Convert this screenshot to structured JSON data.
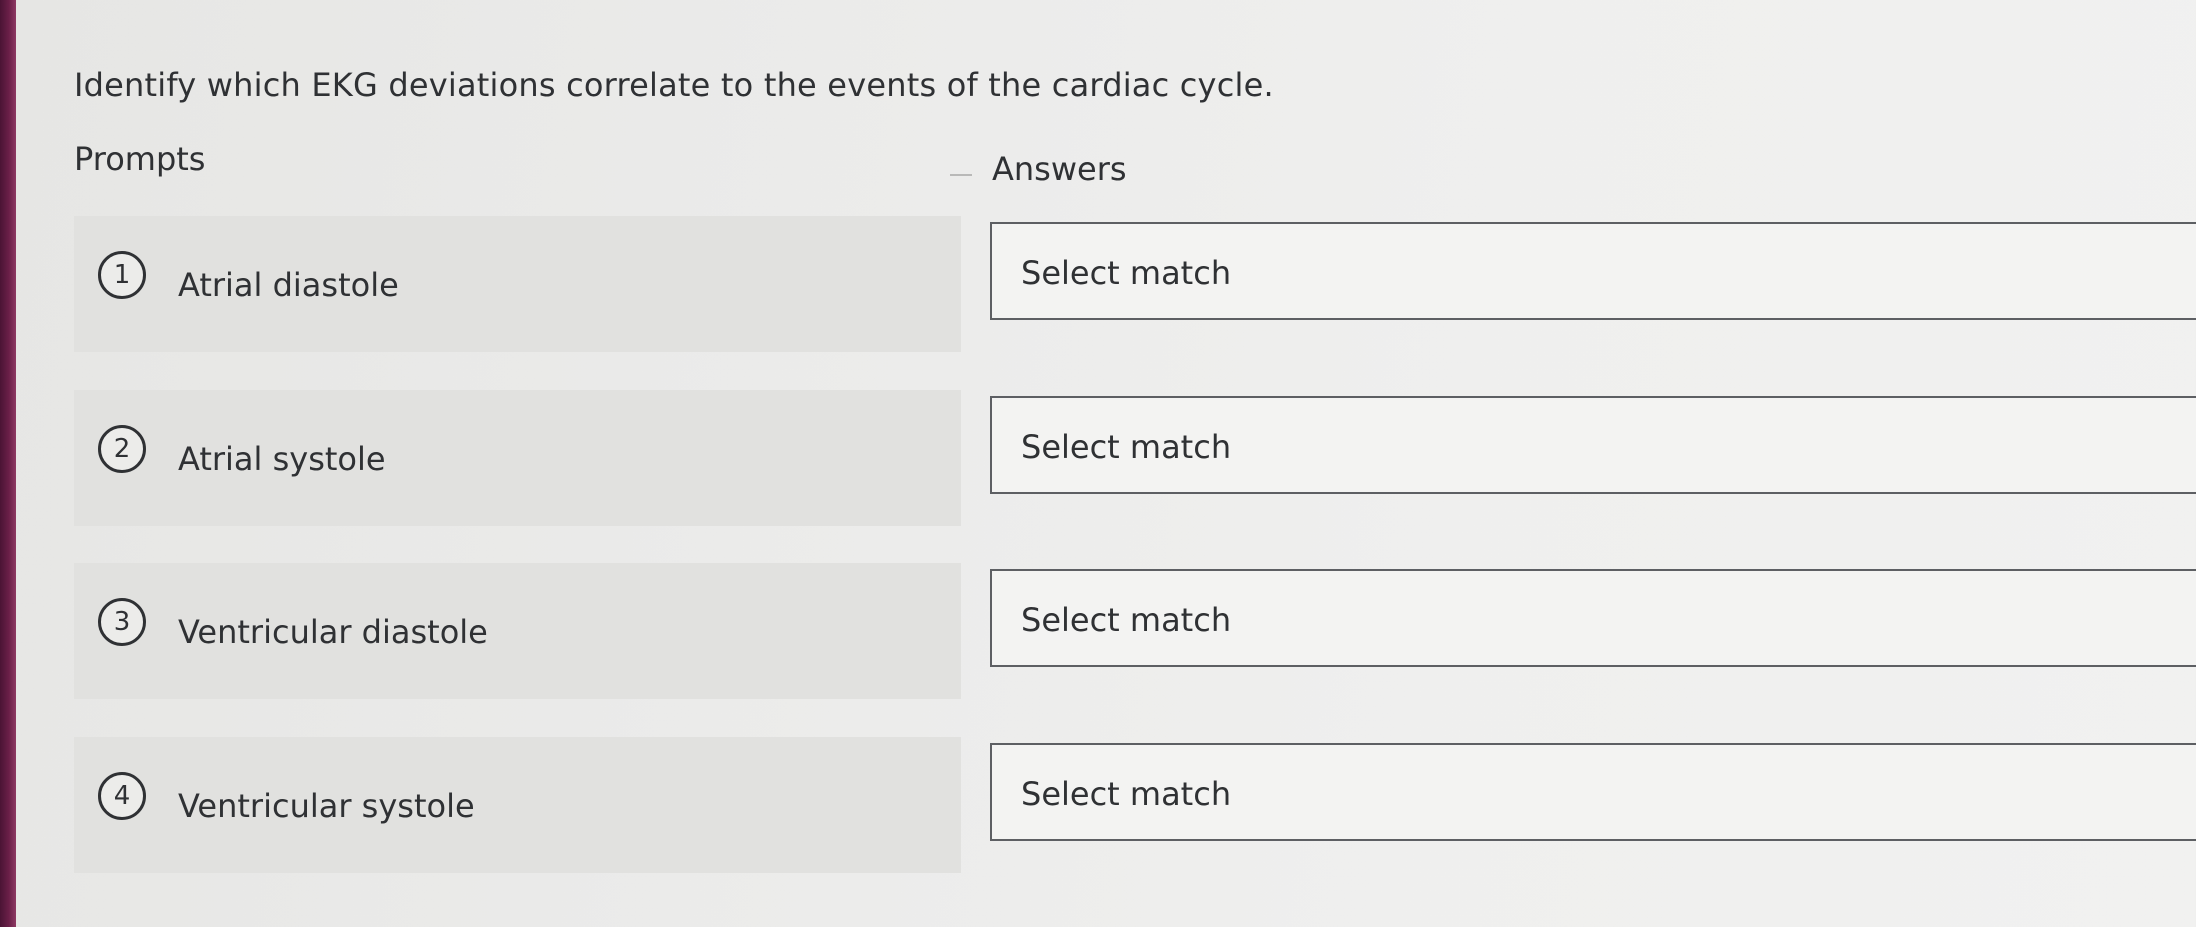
{
  "question": "Identify which EKG deviations correlate to the events of the cardiac cycle.",
  "headers": {
    "prompts": "Prompts",
    "answers": "Answers"
  },
  "prompts": [
    {
      "number": "1",
      "label": "Atrial diastole"
    },
    {
      "number": "2",
      "label": "Atrial systole"
    },
    {
      "number": "3",
      "label": "Ventricular diastole"
    },
    {
      "number": "4",
      "label": "Ventricular systole"
    }
  ],
  "answers": [
    {
      "value": "Select match"
    },
    {
      "value": "Select match"
    },
    {
      "value": "Select match"
    },
    {
      "value": "Select match"
    }
  ]
}
